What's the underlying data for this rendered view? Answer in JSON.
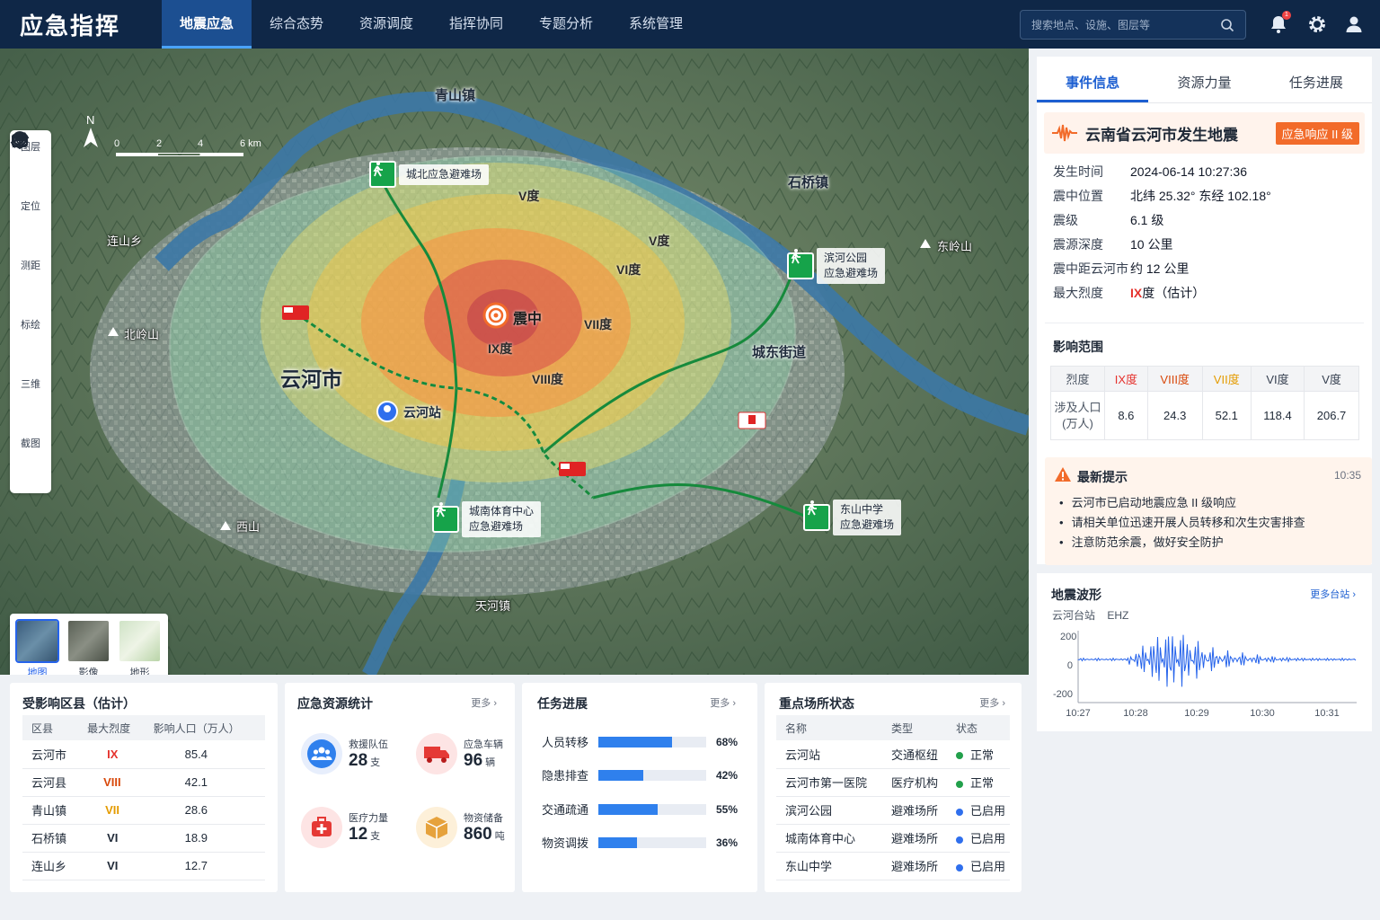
{
  "app": {
    "title": "应急指挥"
  },
  "nav": [
    {
      "label": "地震应急",
      "active": true
    },
    {
      "label": "综合态势"
    },
    {
      "label": "资源调度"
    },
    {
      "label": "指挥协同"
    },
    {
      "label": "专题分析"
    },
    {
      "label": "系统管理"
    }
  ],
  "search": {
    "placeholder": "搜索地点、设施、图层等"
  },
  "notifications": {
    "count": "1"
  },
  "tools": [
    {
      "label": "图层",
      "icon": "layers-icon"
    },
    {
      "label": "定位",
      "icon": "location-icon"
    },
    {
      "label": "测距",
      "icon": "ruler-icon"
    },
    {
      "label": "标绘",
      "icon": "pen-icon"
    },
    {
      "label": "三维",
      "icon": "cube-icon"
    },
    {
      "label": "截图",
      "icon": "screenshot-icon"
    }
  ],
  "scale": {
    "north": "N",
    "ticks": [
      "0",
      "2",
      "4",
      "6 km"
    ]
  },
  "basemaps": [
    {
      "label": "地图",
      "active": true
    },
    {
      "label": "影像"
    },
    {
      "label": "地形"
    }
  ],
  "map": {
    "places": {
      "qingshan": "青山镇",
      "shiqiao": "石桥镇",
      "lianshan": "连山乡",
      "beiling": "北岭山",
      "dongling": "东岭山",
      "xishan": "西山",
      "tianhe": "天河镇",
      "city": "云河市",
      "chengdong": "城东街道",
      "station": "云河站"
    },
    "epicenter": "震中",
    "intensity": {
      "v": "V度",
      "vi": "VI度",
      "vii": "VII度",
      "viii": "VIII度",
      "ix": "IX度"
    },
    "shelters": {
      "north": {
        "l1": "城北应急避难场"
      },
      "binhe": {
        "l1": "滨河公园",
        "l2": "应急避难场"
      },
      "south": {
        "l1": "城南体育中心",
        "l2": "应急避难场"
      },
      "dongshan": {
        "l1": "东山中学",
        "l2": "应急避难场"
      }
    }
  },
  "right": {
    "tabs": [
      {
        "label": "事件信息",
        "active": true
      },
      {
        "label": "资源力量"
      },
      {
        "label": "任务进展"
      }
    ],
    "event": {
      "title": "云南省云河市发生地震",
      "badge": "应急响应 II 级"
    },
    "details": [
      {
        "k": "发生时间",
        "v": "2024-06-14  10:27:36"
      },
      {
        "k": "震中位置",
        "v": "北纬 25.32°    东经 102.18°"
      },
      {
        "k": "震级",
        "v": "6.1 级"
      },
      {
        "k": "震源深度",
        "v": "10 公里"
      },
      {
        "k": "震中距云河市",
        "v": "约 12 公里"
      }
    ],
    "max_intensity": {
      "k": "最大烈度",
      "v_main": "IX",
      "v_rest": "度（估计）"
    },
    "impact": {
      "title": "影响范围",
      "row1": "烈度",
      "row2": "涉及人口(万人)",
      "row2a": "涉及人口",
      "row2b": "(万人)",
      "cols": [
        {
          "h": "IX度",
          "v": "8.6",
          "color": "#e5322d"
        },
        {
          "h": "VIII度",
          "v": "24.3",
          "color": "#d8480a"
        },
        {
          "h": "VII度",
          "v": "52.1",
          "color": "#e49b00"
        },
        {
          "h": "VI度",
          "v": "118.4",
          "color": "#374151"
        },
        {
          "h": "V度",
          "v": "206.7",
          "color": "#374151"
        }
      ]
    },
    "tip": {
      "title": "最新提示",
      "time": "10:35",
      "items": [
        "云河市已启动地震应急 II 级响应",
        "请相关单位迅速开展人员转移和次生灾害排查",
        "注意防范余震，做好安全防护"
      ]
    },
    "wave": {
      "title": "地震波形",
      "more": "更多台站",
      "station": "云河台站",
      "channel": "EHZ",
      "y_ticks": [
        "200",
        "0",
        "-200"
      ],
      "x_ticks": [
        "10:27",
        "10:28",
        "10:29",
        "10:30",
        "10:31"
      ]
    }
  },
  "bottom": {
    "affected": {
      "title": "受影响区县（估计）",
      "headers": [
        "区县",
        "最大烈度",
        "影响人口（万人）"
      ],
      "rows": [
        {
          "name": "云河市",
          "int": "IX",
          "pop": "85.4",
          "color": "#e5322d"
        },
        {
          "name": "云河县",
          "int": "VIII",
          "pop": "42.1",
          "color": "#d8480a"
        },
        {
          "name": "青山镇",
          "int": "VII",
          "pop": "28.6",
          "color": "#e49b00"
        },
        {
          "name": "石桥镇",
          "int": "VI",
          "pop": "18.9",
          "color": "#1f2937"
        },
        {
          "name": "连山乡",
          "int": "VI",
          "pop": "12.7",
          "color": "#1f2937"
        }
      ]
    },
    "resources": {
      "title": "应急资源统计",
      "more": "更多",
      "items": [
        {
          "name": "救援队伍",
          "value": "28",
          "unit": "支"
        },
        {
          "name": "应急车辆",
          "value": "96",
          "unit": "辆"
        },
        {
          "name": "医疗力量",
          "value": "12",
          "unit": "支"
        },
        {
          "name": "物资储备",
          "value": "860",
          "unit": "吨"
        }
      ]
    },
    "tasks": {
      "title": "任务进展",
      "more": "更多",
      "items": [
        {
          "name": "人员转移",
          "pct": 68,
          "label": "68%"
        },
        {
          "name": "隐患排查",
          "pct": 42,
          "label": "42%"
        },
        {
          "name": "交通疏通",
          "pct": 55,
          "label": "55%"
        },
        {
          "name": "物资调拨",
          "pct": 36,
          "label": "36%"
        }
      ]
    },
    "sites": {
      "title": "重点场所状态",
      "more": "更多",
      "headers": [
        "名称",
        "类型",
        "状态"
      ],
      "rows": [
        {
          "name": "云河站",
          "type": "交通枢纽",
          "status": "正常",
          "color": "#22a04b"
        },
        {
          "name": "云河市第一医院",
          "type": "医疗机构",
          "status": "正常",
          "color": "#22a04b"
        },
        {
          "name": "滨河公园",
          "type": "避难场所",
          "status": "已启用",
          "color": "#2f6fed"
        },
        {
          "name": "城南体育中心",
          "type": "避难场所",
          "status": "已启用",
          "color": "#2f6fed"
        },
        {
          "name": "东山中学",
          "type": "避难场所",
          "status": "已启用",
          "color": "#2f6fed"
        }
      ]
    }
  }
}
